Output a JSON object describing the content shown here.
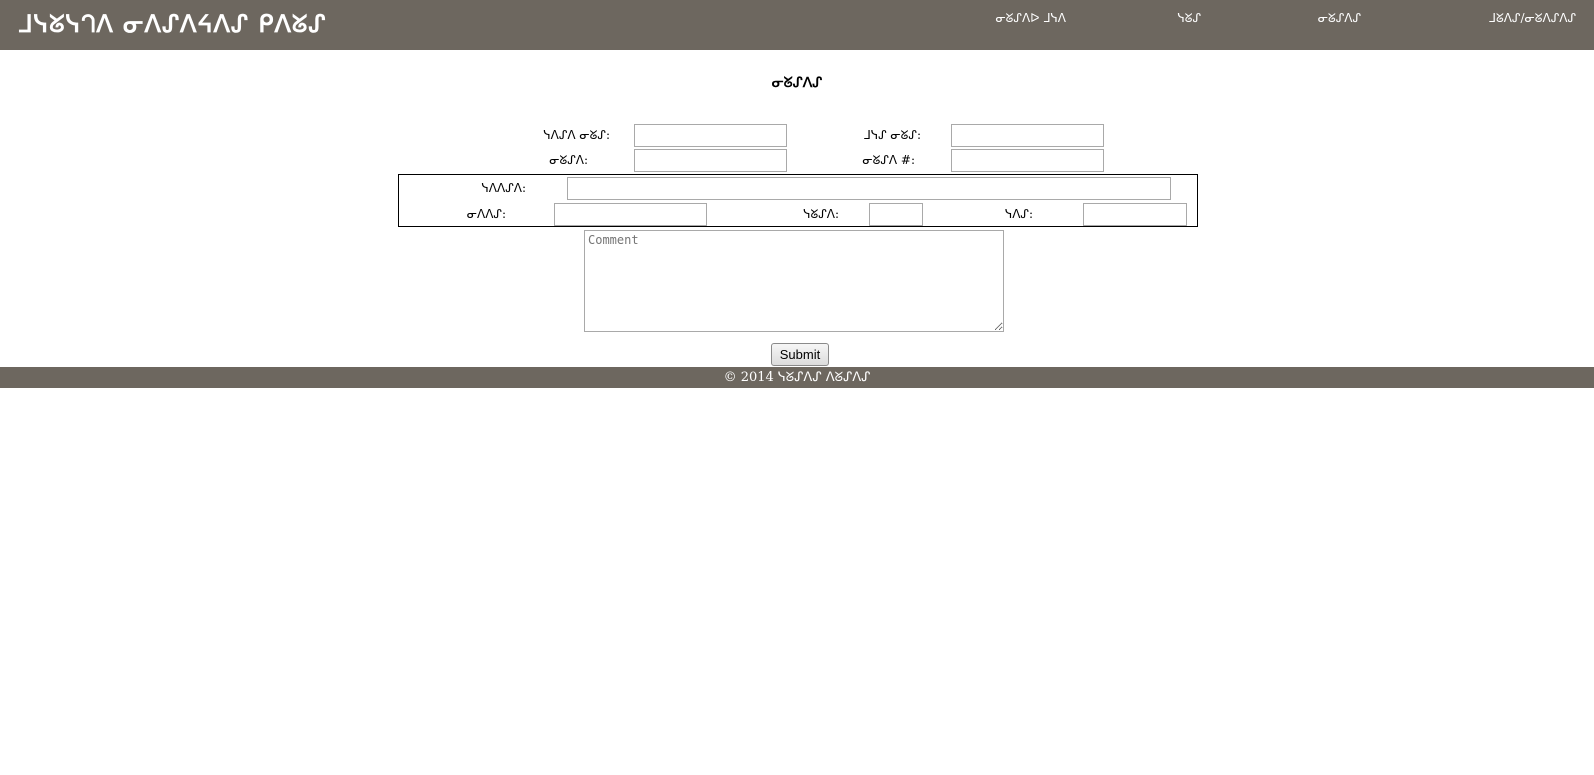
{
  "header": {
    "site_title": "ᒧᓭᘜᓭᘃᐱ ᓂᐱᔑᐱᔦᐱᔑ ᑭᐱᘜᔑ",
    "nav": [
      {
        "label": "ᓂᘜᔑᐱᐅ ᒧᓭᐱ"
      },
      {
        "label": "ᓭᘜᔑ"
      },
      {
        "label": "ᓂᘜᔑᐱᔑ"
      },
      {
        "label": "ᒧᘜᐱᔑ/ᓂᘜᐱᔑᐱᔑ"
      }
    ]
  },
  "page": {
    "title": "ᓂᘜᔑᐱᔑ"
  },
  "form": {
    "first_name_label": "ᓭᐱᔑᐱ ᓂᘜᔑ:",
    "last_name_label": "ᒧᓭᔑ ᓂᘜᔑ:",
    "email_label": "ᓂᘜᔑᐱ:",
    "phone_label": "ᓂᘜᔑᐱ #:",
    "address_label": "ᓭᐱᐱᔑᐱ:",
    "city_label": "ᓂᐱᐱᔑ:",
    "state_label": "ᓭᘜᔑᐱ:",
    "zip_label": "ᓭᐱᔑ:",
    "first_name_value": "",
    "last_name_value": "",
    "email_value": "",
    "phone_value": "",
    "address_value": "",
    "city_value": "",
    "state_value": "",
    "zip_value": "",
    "comment_placeholder": "Comment",
    "submit_label": "Submit"
  },
  "footer": {
    "text": "© 2014 ᓭᘜᔑᐱᔑ ᐱᘜᔑᐱᔑ"
  },
  "colors": {
    "header_bg": "#6d675f",
    "footer_bg": "#6d675f",
    "header_text": "#ffffff"
  }
}
